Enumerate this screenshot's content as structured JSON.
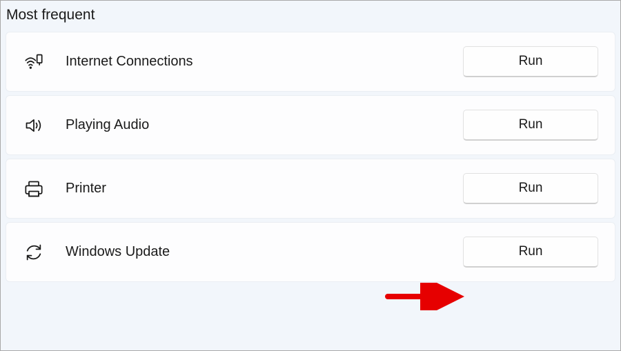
{
  "section_title": "Most frequent",
  "troubleshooters": [
    {
      "id": "internet",
      "label": "Internet Connections",
      "button_label": "Run"
    },
    {
      "id": "audio",
      "label": "Playing Audio",
      "button_label": "Run"
    },
    {
      "id": "printer",
      "label": "Printer",
      "button_label": "Run"
    },
    {
      "id": "windows-update",
      "label": "Windows Update",
      "button_label": "Run"
    }
  ],
  "annotation": {
    "type": "arrow",
    "color": "#e60000",
    "points_to": "windows-update-run-button"
  }
}
